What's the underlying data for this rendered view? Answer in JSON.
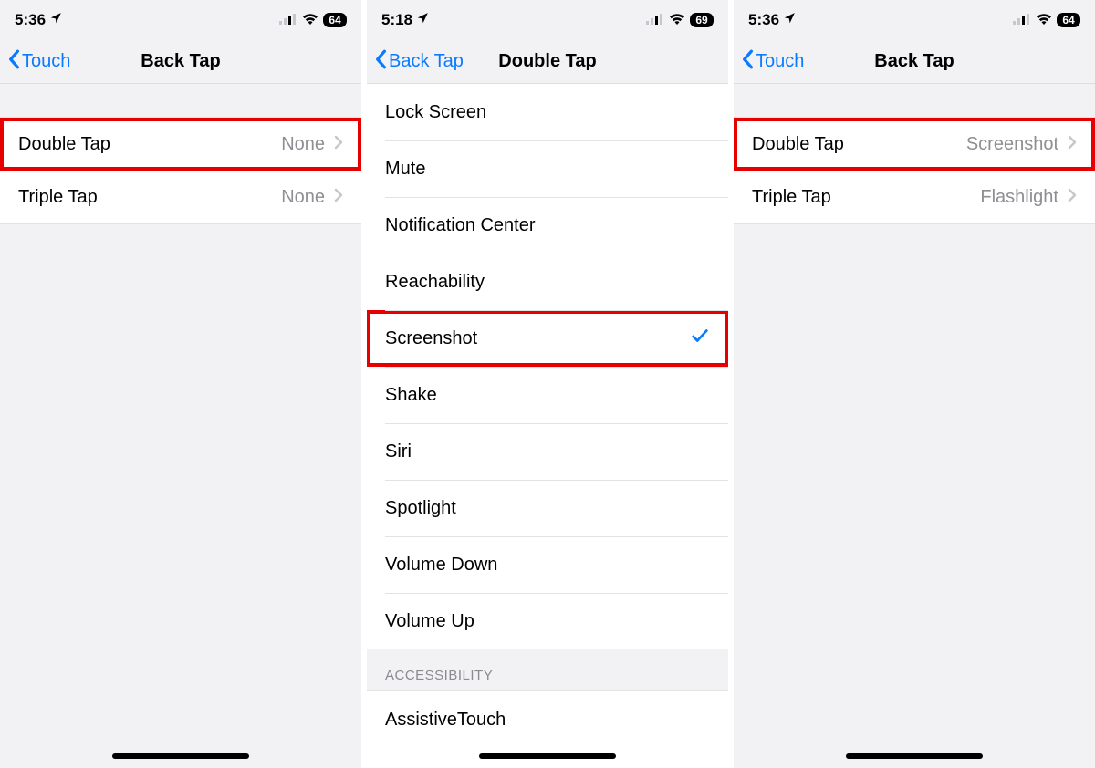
{
  "screens": [
    {
      "status": {
        "time": "5:36",
        "battery": "64"
      },
      "nav": {
        "back": "Touch",
        "title": "Back Tap"
      },
      "rows": [
        {
          "label": "Double Tap",
          "value": "None",
          "highlight": true
        },
        {
          "label": "Triple Tap",
          "value": "None",
          "highlight": false
        }
      ]
    },
    {
      "status": {
        "time": "5:18",
        "battery": "69"
      },
      "nav": {
        "back": "Back Tap",
        "title": "Double Tap"
      },
      "options": [
        {
          "label": "Lock Screen",
          "checked": false
        },
        {
          "label": "Mute",
          "checked": false
        },
        {
          "label": "Notification Center",
          "checked": false
        },
        {
          "label": "Reachability",
          "checked": false
        },
        {
          "label": "Screenshot",
          "checked": true,
          "highlight": true
        },
        {
          "label": "Shake",
          "checked": false
        },
        {
          "label": "Siri",
          "checked": false
        },
        {
          "label": "Spotlight",
          "checked": false
        },
        {
          "label": "Volume Down",
          "checked": false
        },
        {
          "label": "Volume Up",
          "checked": false
        }
      ],
      "section_header": "ACCESSIBILITY",
      "section_items": [
        {
          "label": "AssistiveTouch"
        }
      ]
    },
    {
      "status": {
        "time": "5:36",
        "battery": "64"
      },
      "nav": {
        "back": "Touch",
        "title": "Back Tap"
      },
      "rows": [
        {
          "label": "Double Tap",
          "value": "Screenshot",
          "highlight": true
        },
        {
          "label": "Triple Tap",
          "value": "Flashlight",
          "highlight": false
        }
      ]
    }
  ]
}
